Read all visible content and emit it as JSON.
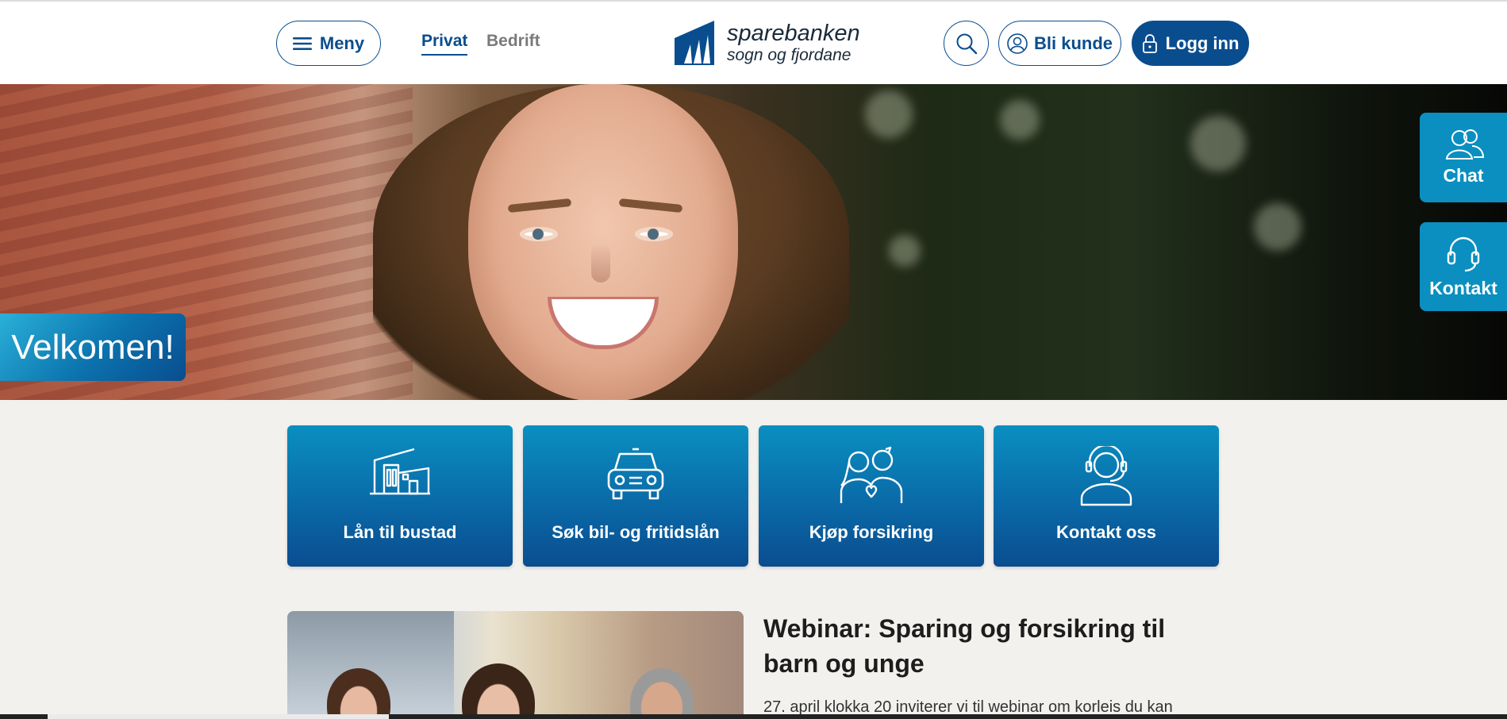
{
  "header": {
    "menu_label": "Meny",
    "tabs": [
      {
        "label": "Privat",
        "active": true
      },
      {
        "label": "Bedrift",
        "active": false
      }
    ],
    "logo": {
      "line1": "sparebanken",
      "line2": "sogn og fjordane"
    },
    "bli_kunde_label": "Bli kunde",
    "logg_inn_label": "Logg inn"
  },
  "hero": {
    "welcome": "Velkomen!"
  },
  "side_actions": [
    {
      "label": "Chat",
      "icon": "people-icon"
    },
    {
      "label": "Kontakt",
      "icon": "headset-icon"
    }
  ],
  "tiles": [
    {
      "label": "Lån til bustad",
      "icon": "house-icon"
    },
    {
      "label": "Søk bil- og fritidslån",
      "icon": "car-icon"
    },
    {
      "label": "Kjøp forsikring",
      "icon": "couple-heart-icon"
    },
    {
      "label": "Kontakt oss",
      "icon": "headset-person-icon"
    }
  ],
  "webinar": {
    "title": "Webinar: Sparing og forsikring til barn og unge",
    "text": "27. april klokka 20 inviterer vi til webinar om korleis du kan"
  },
  "colors": {
    "brand": "#0a4d8f",
    "accent": "#0a8fc0",
    "background": "#f3f1ed"
  }
}
